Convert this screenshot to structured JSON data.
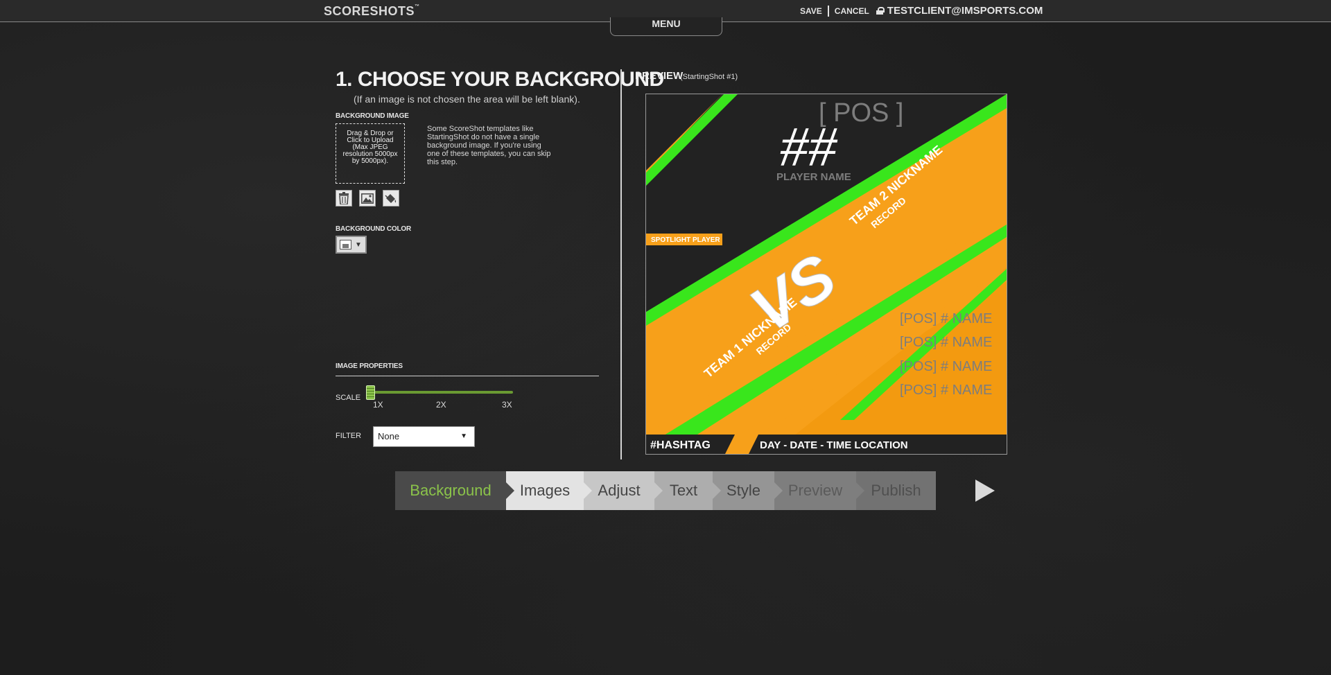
{
  "topbar": {
    "logo": "SCORESHOTS",
    "logo_tm": "™",
    "save_label": "SAVE",
    "cancel_label": "CANCEL",
    "user_email": "TESTCLIENT@IMSPORTS.COM",
    "menu_label": "MENU"
  },
  "background_step": {
    "title": "1. CHOOSE YOUR BACKGROUND",
    "subtitle": "(If an image is not chosen the area will be left blank).",
    "background_image_label": "BACKGROUND IMAGE",
    "dropzone_text": "Drag & Drop or Click to Upload (Max JPEG resolution 5000px by 5000px).",
    "help_text": "Some ScoreShot templates like StartingShot do not have a single background image. If you're using one of these templates, you can skip this step.",
    "icons": [
      "trash-icon",
      "image-icon",
      "paint-bucket-icon"
    ],
    "background_color_label": "BACKGROUND COLOR",
    "image_properties_label": "IMAGE PROPERTIES",
    "scale_label": "SCALE",
    "scale_ticks": [
      "1X",
      "2X",
      "3X"
    ],
    "scale_value": "1X",
    "filter_label": "FILTER",
    "filter_value": "None"
  },
  "preview": {
    "label": "PREVIEW",
    "template": "(StartingShot #1)",
    "pos_top": "[ POS ]",
    "number": "##",
    "player_name": "PLAYER NAME",
    "spotlight": "SPOTLIGHT PLAYER",
    "vs": "VS",
    "team1": "TEAM 1 NICKNAME",
    "team1_record": "RECORD",
    "team2": "TEAM 2 NICKNAME",
    "team2_record": "RECORD",
    "roster": [
      "[POS] # NAME",
      "[POS] # NAME",
      "[POS] # NAME",
      "[POS] # NAME"
    ],
    "hashtag": "#HASHTAG",
    "event_line": "DAY - DATE - TIME LOCATION",
    "colors": {
      "orange": "#F7A01A",
      "green": "#39E61C",
      "dark": "#222222"
    }
  },
  "steps": {
    "items": [
      {
        "label": "Background",
        "bg": "#4a4a4a",
        "color": "#8bc34a"
      },
      {
        "label": "Images",
        "bg": "#e3e3e3",
        "color": "#444444"
      },
      {
        "label": "Adjust",
        "bg": "#c7c7c7",
        "color": "#444444"
      },
      {
        "label": "Text",
        "bg": "#adadad",
        "color": "#444444"
      },
      {
        "label": "Style",
        "bg": "#959595",
        "color": "#444444"
      },
      {
        "label": "Preview",
        "bg": "#7e7e7e",
        "color": "#5a5a5a"
      },
      {
        "label": "Publish",
        "bg": "#727272",
        "color": "#4f4f4f"
      }
    ]
  }
}
